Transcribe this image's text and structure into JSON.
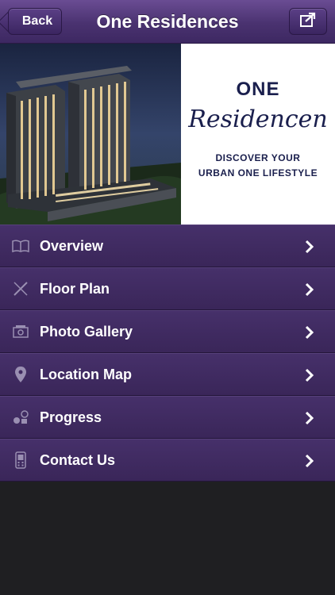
{
  "navbar": {
    "back_label": "Back",
    "title": "One Residences"
  },
  "banner": {
    "brand_one": "ONE",
    "brand_script": "Residencen",
    "tagline_line1": "DISCOVER YOUR",
    "tagline_line2": "URBAN ONE LIFESTYLE"
  },
  "menu": {
    "items": [
      {
        "label": "Overview",
        "icon": "book-icon"
      },
      {
        "label": "Floor Plan",
        "icon": "ruler-pencil-icon"
      },
      {
        "label": "Photo Gallery",
        "icon": "photo-icon"
      },
      {
        "label": "Location Map",
        "icon": "map-pin-icon"
      },
      {
        "label": "Progress",
        "icon": "progress-icon"
      },
      {
        "label": "Contact Us",
        "icon": "phone-icon"
      }
    ]
  },
  "colors": {
    "navbar": "#4a3270",
    "menu_bg": "#3f2a60",
    "page_bg": "#1f1f22",
    "brand_text": "#1a1f4d"
  }
}
